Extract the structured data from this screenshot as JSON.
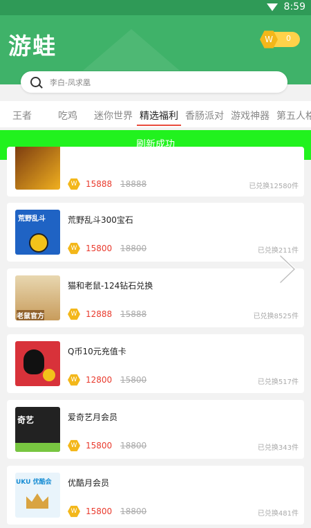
{
  "status": {
    "time": "8:59"
  },
  "header": {
    "title": "游蛙",
    "coin_icon_letter": "W",
    "coin_value": "0"
  },
  "search": {
    "placeholder": "李白-凤求凰"
  },
  "tabs": [
    "王者",
    "吃鸡",
    "迷你世界",
    "精选福利",
    "香肠派对",
    "游戏神器",
    "第五人格"
  ],
  "active_tab": "精选福利",
  "toast": "刷新成功",
  "cards": [
    {
      "name": "",
      "price": "15888",
      "orig": "18888",
      "sold": "已兑换12580件",
      "thumb_text": "",
      "thumb_colors": [
        "#7a3a10",
        "#f0b020"
      ]
    },
    {
      "name": "荒野乱斗300宝石",
      "price": "15800",
      "orig": "18800",
      "sold": "已兑换211件",
      "thumb_text": "荒野乱斗",
      "thumb_colors": [
        "#1f63c4",
        "#e8302d"
      ]
    },
    {
      "name": "猫和老鼠-124钻石兑换",
      "price": "12888",
      "orig": "15888",
      "sold": "已兑换8525件",
      "thumb_text": "老鼠官方",
      "thumb_colors": [
        "#d9b98a",
        "#8a6a3a"
      ]
    },
    {
      "name": "Q币10元充值卡",
      "price": "12800",
      "orig": "15800",
      "sold": "已兑换517件",
      "thumb_text": "",
      "thumb_colors": [
        "#d8323a",
        "#111111"
      ]
    },
    {
      "name": "爱奇艺月会员",
      "price": "15800",
      "orig": "18800",
      "sold": "已兑换343件",
      "thumb_text": "奇艺",
      "thumb_colors": [
        "#222222",
        "#78c641"
      ]
    },
    {
      "name": "优酷月会员",
      "price": "15800",
      "orig": "18800",
      "sold": "已兑换481件",
      "thumb_text": "UKU 优酷会",
      "thumb_colors": [
        "#e9f4fb",
        "#d9a441"
      ]
    }
  ],
  "coin_small_letter": "W",
  "icons": {
    "search": "search-icon",
    "wifi": "wifi-icon",
    "next": "chevron-right-icon",
    "coin": "coin-icon"
  },
  "colors": {
    "brand_green": "#3fb269",
    "toast_green": "#21f21e",
    "price_red": "#e93a2d",
    "coin_gold": "#f3b71a"
  }
}
